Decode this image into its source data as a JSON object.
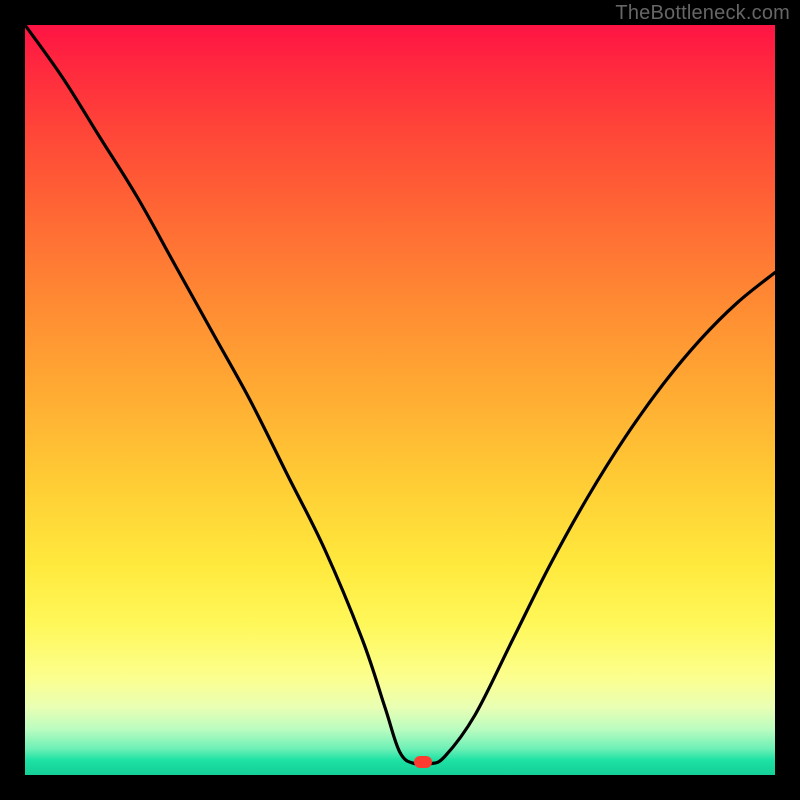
{
  "watermark": "TheBottleneck.com",
  "colors": {
    "page_bg": "#000000",
    "gradient_top": "#ff1444",
    "gradient_bottom": "#15d098",
    "curve": "#000000",
    "marker": "#ff3a2f",
    "watermark_text": "#666666"
  },
  "chart_data": {
    "type": "line",
    "title": "",
    "xlabel": "",
    "ylabel": "",
    "xlim": [
      0,
      100
    ],
    "ylim": [
      0,
      100
    ],
    "grid": false,
    "legend": false,
    "annotations": [
      {
        "text": "TheBottleneck.com",
        "pos": "top-right"
      }
    ],
    "marker": {
      "x": 53,
      "y": 1.8,
      "shape": "lozenge",
      "color": "#ff3a2f"
    },
    "series": [
      {
        "name": "bottleneck-curve",
        "x": [
          0,
          5,
          10,
          15,
          20,
          25,
          30,
          35,
          40,
          45,
          48,
          50,
          52,
          54,
          56,
          60,
          65,
          70,
          75,
          80,
          85,
          90,
          95,
          100
        ],
        "values": [
          100,
          93,
          85,
          77,
          68,
          59,
          50,
          40,
          30,
          18,
          9,
          3,
          1.5,
          1.5,
          2.5,
          8,
          18,
          28,
          37,
          45,
          52,
          58,
          63,
          67
        ]
      }
    ],
    "background_gradient_stops": [
      {
        "pos": 0.0,
        "color": "#ff1444"
      },
      {
        "pos": 0.26,
        "color": "#ff6a34"
      },
      {
        "pos": 0.5,
        "color": "#ffae33"
      },
      {
        "pos": 0.72,
        "color": "#ffe93d"
      },
      {
        "pos": 0.87,
        "color": "#fcff8e"
      },
      {
        "pos": 0.94,
        "color": "#b8fcc0"
      },
      {
        "pos": 0.98,
        "color": "#1ee2a4"
      },
      {
        "pos": 1.0,
        "color": "#15d098"
      }
    ]
  }
}
